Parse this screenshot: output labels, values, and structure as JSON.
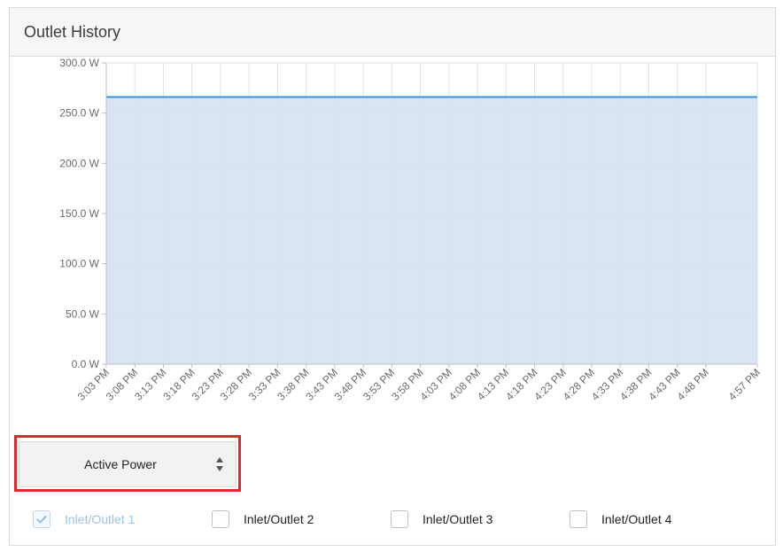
{
  "panel": {
    "title": "Outlet History"
  },
  "chart_data": {
    "type": "area",
    "y_tick_labels": [
      "0.0 W",
      "50.0 W",
      "100.0 W",
      "150.0 W",
      "200.0 W",
      "250.0 W",
      "300.0 W"
    ],
    "ylim": [
      0,
      300
    ],
    "x_tick_labels": [
      "3:03 PM",
      "3:08 PM",
      "3:13 PM",
      "3:18 PM",
      "3:23 PM",
      "3:28 PM",
      "3:33 PM",
      "3:38 PM",
      "3:43 PM",
      "3:48 PM",
      "3:53 PM",
      "3:58 PM",
      "4:03 PM",
      "4:08 PM",
      "4:13 PM",
      "4:18 PM",
      "4:23 PM",
      "4:28 PM",
      "4:33 PM",
      "4:38 PM",
      "4:43 PM",
      "4:48 PM",
      "4:57 PM"
    ],
    "x_tick_minutes": [
      0,
      5,
      10,
      15,
      20,
      25,
      30,
      35,
      40,
      45,
      50,
      55,
      60,
      65,
      70,
      75,
      80,
      85,
      90,
      95,
      100,
      105,
      114
    ],
    "series": [
      {
        "x": [
          "3:03 PM",
          "4:57 PM"
        ],
        "values": [
          266,
          266
        ]
      }
    ],
    "grid": true,
    "colors": {
      "line": "#3d8fd8",
      "fill": "#d3e0f2",
      "grid": "#e2e2e2",
      "axis": "#bdbdbd"
    }
  },
  "metric_select": {
    "value": "Active Power",
    "highlight_color": "#e0262e"
  },
  "checkboxes": [
    {
      "label": "Inlet/Outlet 1",
      "checked": true,
      "disabled": true
    },
    {
      "label": "Inlet/Outlet 2",
      "checked": false,
      "disabled": false
    },
    {
      "label": "Inlet/Outlet 3",
      "checked": false,
      "disabled": false
    },
    {
      "label": "Inlet/Outlet 4",
      "checked": false,
      "disabled": false
    }
  ]
}
